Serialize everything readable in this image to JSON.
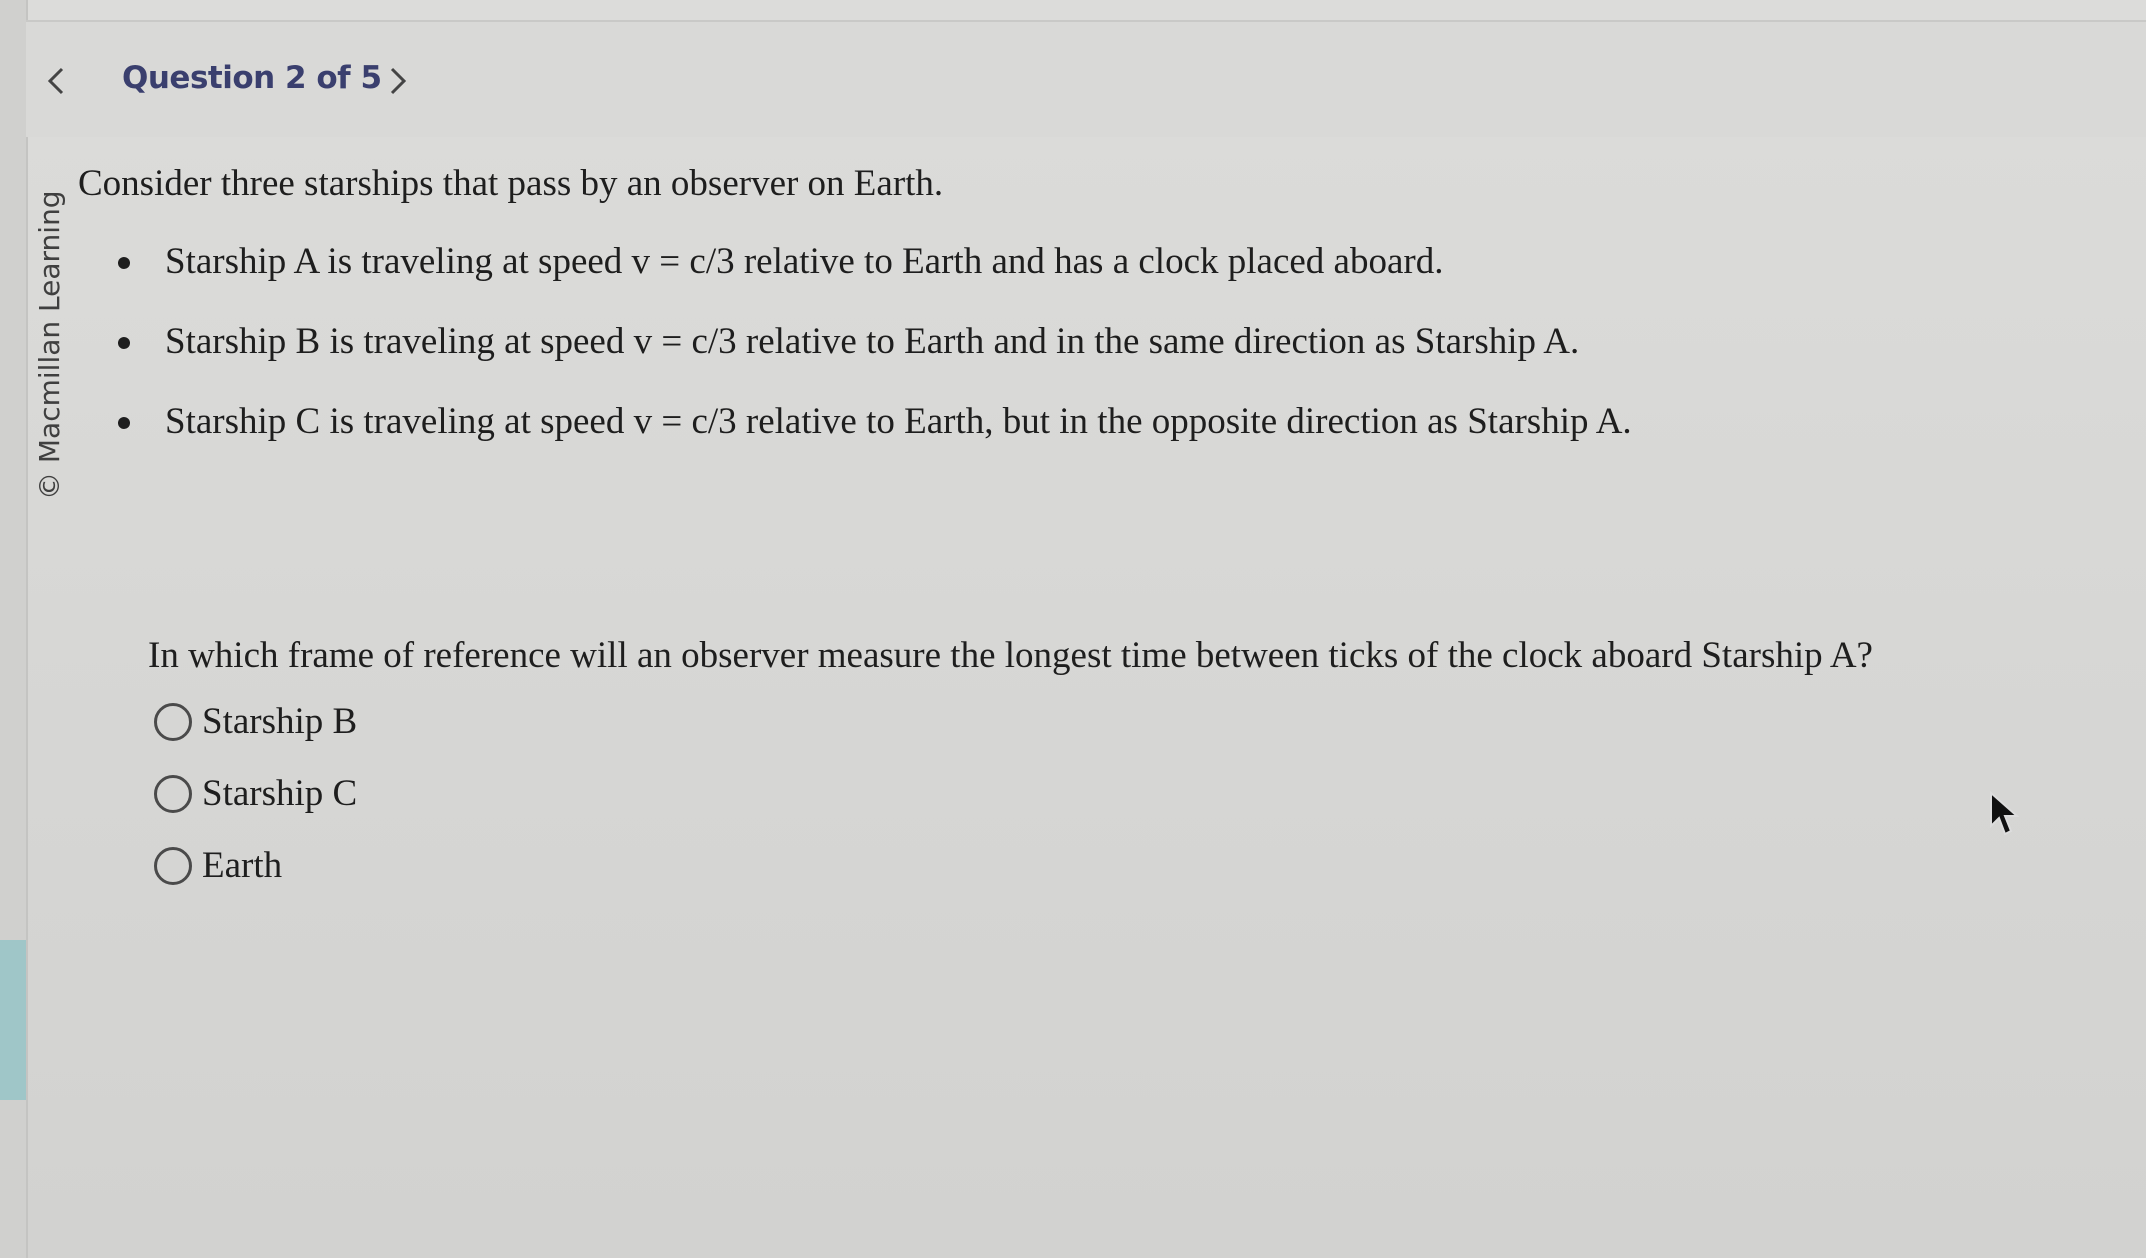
{
  "header": {
    "question_counter": "Question 2 of 5",
    "prev_icon": "chevron-left-icon",
    "next_icon": "chevron-right-icon"
  },
  "copyright": "© Macmillan Learning",
  "problem": {
    "intro": "Consider three starships that pass by an observer on Earth.",
    "bullets": [
      "Starship A is traveling at speed v = c/3 relative to Earth and has a clock placed aboard.",
      "Starship B is traveling at speed v = c/3 relative to Earth and in the same direction as Starship A.",
      "Starship C is traveling at speed v = c/3 relative to Earth, but in the opposite direction as Starship A."
    ]
  },
  "question": {
    "prompt": "In which frame of reference will an observer measure the longest time between ticks of the clock aboard Starship A?",
    "options": [
      "Starship B",
      "Starship C",
      "Earth"
    ],
    "selected": null
  },
  "colors": {
    "header_text": "#3a3f6e",
    "body_text": "#1e1e1e",
    "left_accent": "#9fc6c8"
  }
}
